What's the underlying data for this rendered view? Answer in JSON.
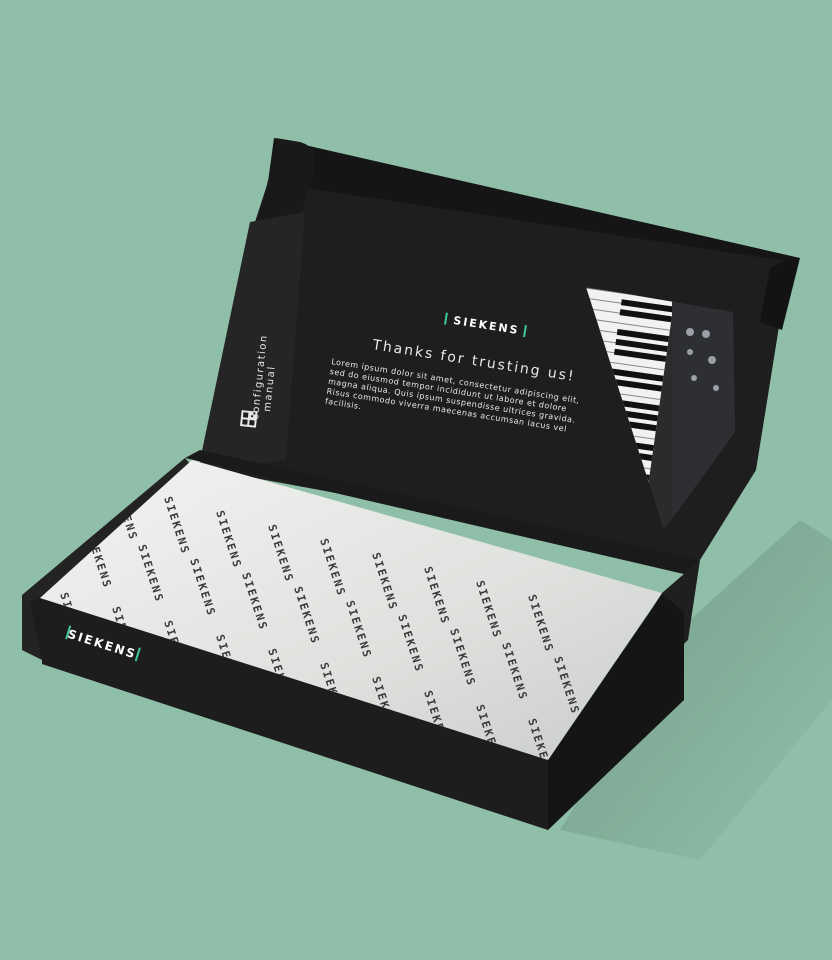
{
  "colors": {
    "background": "#8fbfa8",
    "box": "#1d1d1d",
    "box_inner": "#262626",
    "accent": "#3fc8a0",
    "paper": "#e4e6e3"
  },
  "lid": {
    "brand": "SIEKENS",
    "headline": "Thanks for trusting us!",
    "body_lines": [
      "Lorem ipsum dolor sit amet, consectetur adipiscing elit,",
      "sed do eiusmod tempor incididunt ut labore et dolore",
      "magna aliqua. Quis ipsum suspendisse ultrices gravida.",
      "Risus commodo viverra maecenas accumsan lacus vel",
      "facilisis."
    ],
    "side_label_1": "configuration",
    "side_label_2": "manual",
    "qr_icon": "qr-code-icon",
    "photo": "keyboard-synthesizer-photo"
  },
  "box_front": {
    "brand": "SIEKENS"
  },
  "tissue_paper": {
    "pattern_word": "SIEKENS"
  }
}
